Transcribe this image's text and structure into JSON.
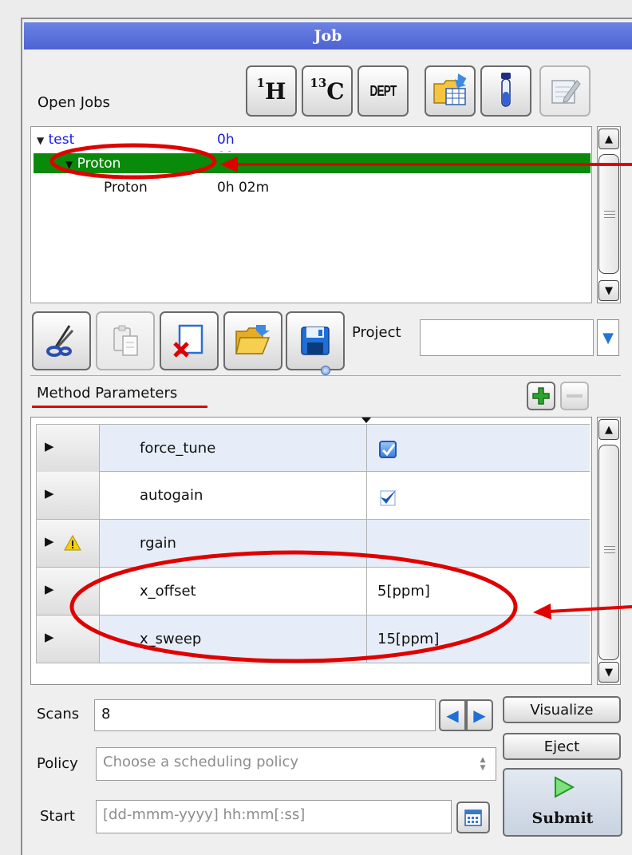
{
  "window": {
    "title": "Job"
  },
  "toolbar": {
    "h1_label": "1H",
    "c13_label": "13C",
    "dept_label": "DEPT"
  },
  "open_jobs": {
    "label": "Open Jobs",
    "rows": [
      {
        "name": "test",
        "time": "0h 02m",
        "color": "#1a1ae6"
      },
      {
        "name": "Proton",
        "time": "",
        "selected": true
      },
      {
        "name": "Proton",
        "time": "0h 02m"
      }
    ]
  },
  "project": {
    "label": "Project",
    "value": ""
  },
  "method_parameters": {
    "label": "Method Parameters",
    "rows": [
      {
        "name": "force_tune",
        "value": "",
        "kind": "checkbox-checked",
        "warning": false
      },
      {
        "name": "autogain",
        "value": "",
        "kind": "checkbox-checked",
        "warning": false
      },
      {
        "name": "rgain",
        "value": "",
        "kind": "text",
        "warning": true
      },
      {
        "name": "x_offset",
        "value": "5[ppm]",
        "kind": "text",
        "warning": false
      },
      {
        "name": "x_sweep",
        "value": "15[ppm]",
        "kind": "text",
        "warning": false
      }
    ]
  },
  "scans": {
    "label": "Scans",
    "value": "8"
  },
  "policy": {
    "label": "Policy",
    "placeholder": "Choose a scheduling policy"
  },
  "start": {
    "label": "Start",
    "placeholder": "[dd-mmm-yyyy] hh:mm[:ss]"
  },
  "buttons": {
    "visualize": "Visualize",
    "eject": "Eject",
    "submit": "Submit"
  },
  "colors": {
    "title_bar": "#5b71da",
    "selection": "#0a8a0a",
    "annotation": "#e00000"
  }
}
